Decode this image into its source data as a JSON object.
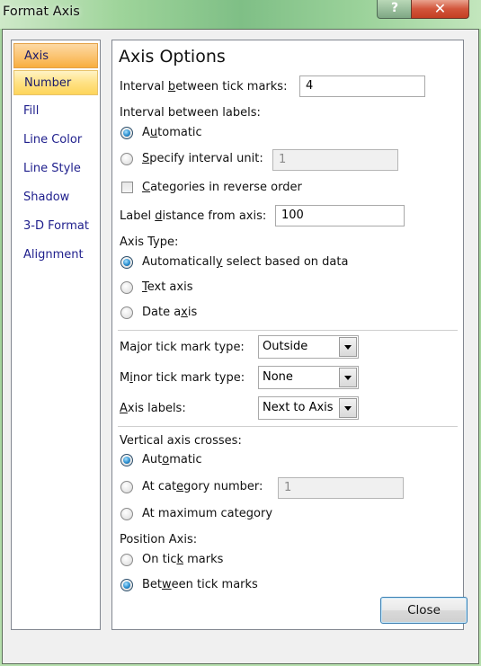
{
  "window": {
    "title": "Format Axis",
    "help_glyph": "?",
    "close_glyph": "✕"
  },
  "nav": {
    "items": [
      {
        "label": "Axis Options",
        "state": "selected"
      },
      {
        "label": "Number",
        "state": "hover"
      },
      {
        "label": "Fill",
        "state": "normal"
      },
      {
        "label": "Line Color",
        "state": "normal"
      },
      {
        "label": "Line Style",
        "state": "normal"
      },
      {
        "label": "Shadow",
        "state": "normal"
      },
      {
        "label": "3-D Format",
        "state": "normal"
      },
      {
        "label": "Alignment",
        "state": "normal"
      }
    ]
  },
  "panel": {
    "heading": "Axis Options",
    "tick_interval": {
      "label_pre": "Interval ",
      "label_ul": "b",
      "label_post": "etween tick marks:",
      "value": "4"
    },
    "label_interval": {
      "label": "Interval between labels:",
      "automatic": {
        "pre": "A",
        "ul": "u",
        "post": "tomatic",
        "checked": true
      },
      "specify": {
        "pre": "",
        "ul": "S",
        "post": "pecify interval unit:",
        "checked": false,
        "value": "1"
      }
    },
    "reverse_order": {
      "pre": "",
      "ul": "C",
      "post": "ategories in reverse order",
      "checked": false
    },
    "label_distance": {
      "pre": "Label ",
      "ul": "d",
      "post": "istance from axis:",
      "value": "100"
    },
    "axis_type": {
      "label": "Axis Type:",
      "auto": {
        "pre": "Automaticall",
        "ul": "y",
        "post": " select based on data",
        "checked": true
      },
      "text": {
        "pre": "",
        "ul": "T",
        "post": "ext axis",
        "checked": false
      },
      "date": {
        "pre": "Date a",
        "ul": "x",
        "post": "is",
        "checked": false
      }
    },
    "major_tick": {
      "pre": "Ma",
      "ul": "j",
      "post": "or tick mark type:",
      "value": "Outside"
    },
    "minor_tick": {
      "pre": "M",
      "ul": "i",
      "post": "nor tick mark type:",
      "value": "None"
    },
    "axis_labels": {
      "pre": "",
      "ul": "A",
      "post": "xis labels:",
      "value": "Next to Axis"
    },
    "vertical_crosses": {
      "label": "Vertical axis crosses:",
      "automatic": {
        "pre": "Aut",
        "ul": "o",
        "post": "matic",
        "checked": true
      },
      "category_number": {
        "pre": "At cat",
        "ul": "e",
        "post": "gory number:",
        "checked": false,
        "value": "1"
      },
      "max_category": {
        "pre": "At maximum cate",
        "ul": "g",
        "post": "ory",
        "checked": false
      }
    },
    "position_axis": {
      "label": "Position Axis:",
      "on_ticks": {
        "pre": "On tic",
        "ul": "k",
        "post": " marks",
        "checked": false
      },
      "between_ticks": {
        "pre": "Bet",
        "ul": "w",
        "post": "een tick marks",
        "checked": true
      }
    }
  },
  "footer": {
    "close_label": "Close"
  }
}
